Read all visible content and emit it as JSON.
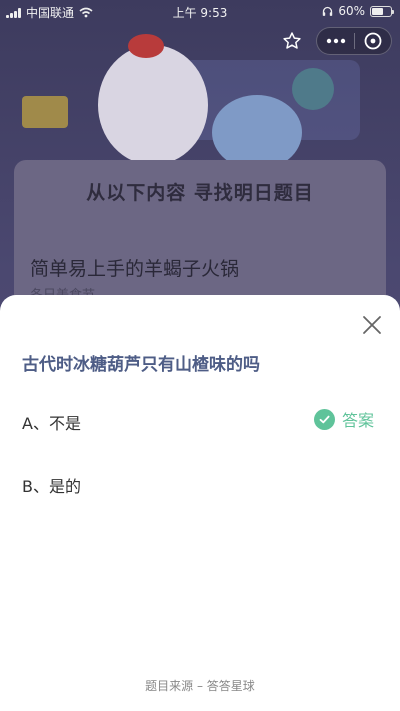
{
  "status_bar": {
    "carrier": "中国联通",
    "time": "上午 9:53",
    "battery": "60%",
    "battery_level": 0.6
  },
  "top_bar": {
    "star_icon": "star-outline-icon",
    "more_icon": "more-dots-icon",
    "close_icon": "circle-close-icon"
  },
  "background": {
    "banner_title": "从以下内容 寻找明日题目",
    "article_title": "简单易上手的羊蝎子火锅",
    "article_source": "冬日美食节"
  },
  "quiz": {
    "question": "古代时冰糖葫芦只有山楂味的吗",
    "options": [
      {
        "label": "A、不是",
        "is_answer": true
      },
      {
        "label": "B、是的",
        "is_answer": false
      }
    ],
    "answer_label": "答案",
    "source": "题目来源 – 答答星球"
  },
  "colors": {
    "accent_green": "#5fc39a",
    "question_blue": "#4e5d86",
    "sheet_bg": "#ffffff"
  }
}
